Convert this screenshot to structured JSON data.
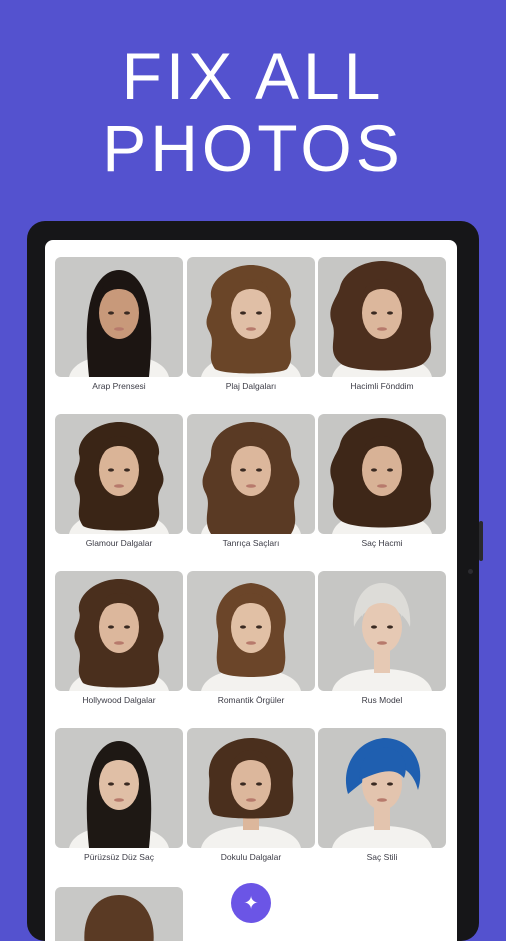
{
  "headline": {
    "line1": "FIX ALL",
    "line2": "PHOTOS"
  },
  "styles": [
    {
      "label": "Arap Prensesi",
      "hair": "#1c1512",
      "bg": "#c8c8c6",
      "skin": "#c8997a",
      "shape": "long-straight"
    },
    {
      "label": "Plaj Dalgaları",
      "hair": "#6a4528",
      "bg": "#c9c9c7",
      "skin": "#e0bfa6",
      "shape": "wavy"
    },
    {
      "label": "Hacimli Fönddim",
      "hair": "#4c2f1e",
      "bg": "#c6c6c4",
      "skin": "#dcb79c",
      "shape": "volume"
    },
    {
      "label": "Glamour Dalgalar",
      "hair": "#3a2516",
      "bg": "#c8c8c6",
      "skin": "#dab497",
      "shape": "wavy"
    },
    {
      "label": "Tanrıça Saçları",
      "hair": "#5a3a24",
      "bg": "#c9c9c7",
      "skin": "#dcb79c",
      "shape": "long-wavy"
    },
    {
      "label": "Saç Hacmi",
      "hair": "#3e2718",
      "bg": "#c6c6c4",
      "skin": "#d8b296",
      "shape": "volume"
    },
    {
      "label": "Hollywood Dalgalar",
      "hair": "#4a2f1d",
      "bg": "#c8c8c6",
      "skin": "#dcb79c",
      "shape": "wavy"
    },
    {
      "label": "Romantik Örgüler",
      "hair": "#6b4529",
      "bg": "#c9c9c7",
      "skin": "#e1c0a5",
      "shape": "braid"
    },
    {
      "label": "Rus Model",
      "hair": "#dddcd8",
      "bg": "#c6c6c4",
      "skin": "#e6c9b4",
      "shape": "updo"
    },
    {
      "label": "Pürüzsüz Düz Saç",
      "hair": "#1e1814",
      "bg": "#c8c8c6",
      "skin": "#e0bfa6",
      "shape": "long-straight"
    },
    {
      "label": "Dokulu Dalgalar",
      "hair": "#4a2f1d",
      "bg": "#c9c9c7",
      "skin": "#dcb79c",
      "shape": "bob"
    },
    {
      "label": "Saç Stili",
      "hair": "#1f5fb0",
      "bg": "#c6c6c4",
      "skin": "#e3c4ae",
      "shape": "pixie"
    }
  ],
  "partial_row_hair": "#5a3a24",
  "fab_icon": "sparkle-icon"
}
